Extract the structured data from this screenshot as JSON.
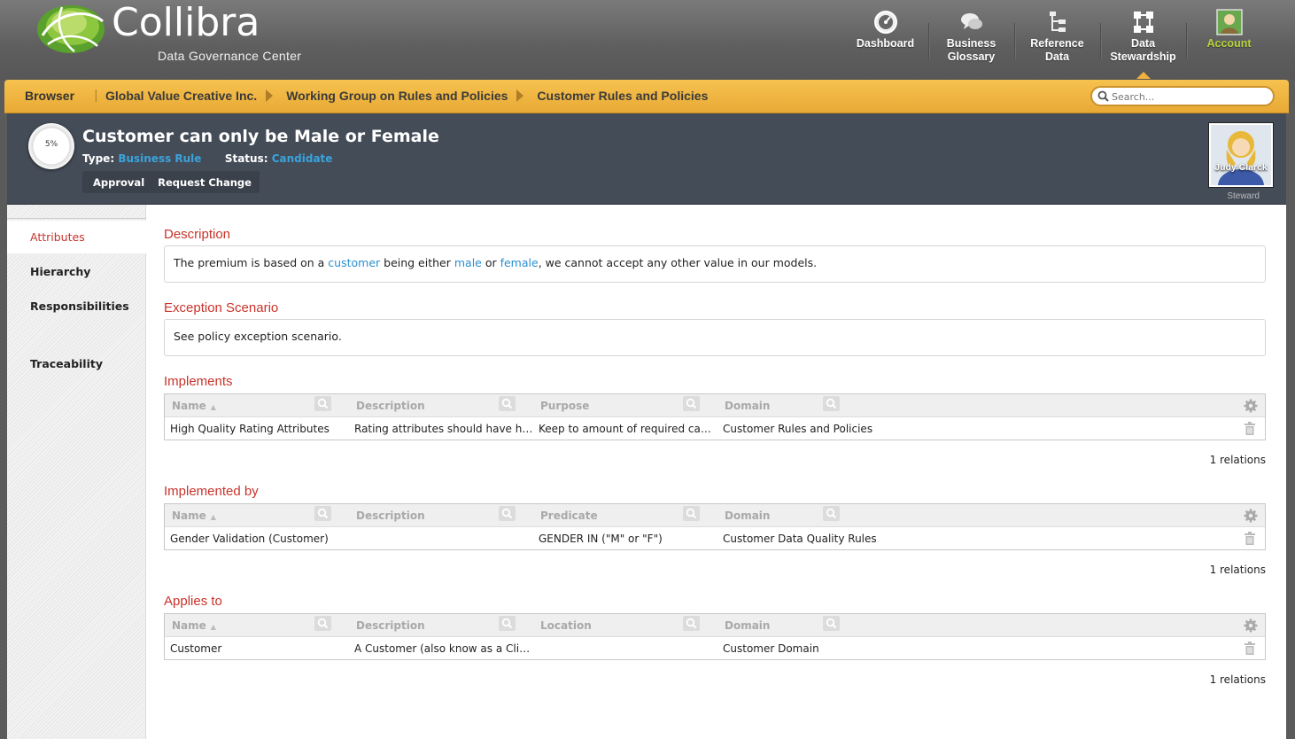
{
  "brand": {
    "name": "Collibra",
    "subtitle": "Data Governance Center",
    "logo_colors": [
      "#8dc63f",
      "#5aa02c",
      "#b9dc6a"
    ]
  },
  "nav": [
    {
      "label": "Dashboard",
      "icon": "dashboard-gauge-icon"
    },
    {
      "label": "Business\nGlossary",
      "icon": "speech-bubbles-icon"
    },
    {
      "label": "Reference\nData",
      "icon": "reference-tree-icon"
    },
    {
      "label": "Data\nStewardship",
      "icon": "stewardship-network-icon",
      "active": true
    },
    {
      "label": "Account",
      "icon": "user-avatar-icon"
    }
  ],
  "breadcrumb": {
    "root": "Browser",
    "separator": "|",
    "items": [
      "Global Value Creative Inc.",
      "Working Group on Rules and Policies",
      "Customer Rules and Policies"
    ]
  },
  "search": {
    "placeholder": "Search..."
  },
  "asset": {
    "progress": "5%",
    "title": "Customer can only be Male or Female",
    "type_label": "Type:",
    "type_value": "Business Rule",
    "status_label": "Status:",
    "status_value": "Candidate",
    "actions": [
      "Approval",
      "Request Change"
    ],
    "steward_name": "Judy Clarck",
    "steward_role": "Steward"
  },
  "sidebar": [
    "Attributes",
    "Hierarchy",
    "Responsibilities",
    "Traceability"
  ],
  "description": {
    "title": "Description",
    "parts": [
      "The premium is based on a ",
      "customer",
      " being either ",
      "male",
      " or ",
      "female",
      ", we cannot accept any other value in our models."
    ]
  },
  "exception": {
    "title": "Exception Scenario",
    "text": "See policy exception scenario."
  },
  "implements": {
    "title": "Implements",
    "columns": [
      "Name",
      "Description",
      "Purpose",
      "Domain"
    ],
    "row": [
      "High Quality Rating Attributes",
      "Rating attributes should have h…",
      "Keep to amount of required ca…",
      "Customer Rules and Policies"
    ],
    "relations": "1 relations"
  },
  "implemented_by": {
    "title": "Implemented by",
    "columns": [
      "Name",
      "Description",
      "Predicate",
      "Domain"
    ],
    "row": [
      "Gender Validation (Customer)",
      "",
      "GENDER IN (\"M\" or \"F\")",
      "Customer Data Quality Rules"
    ],
    "relations": "1 relations"
  },
  "applies_to": {
    "title": "Applies to",
    "columns": [
      "Name",
      "Description",
      "Location",
      "Domain"
    ],
    "row": [
      "Customer",
      "A Customer (also know as a Cli…",
      "",
      "Customer Domain"
    ],
    "relations": "1 relations"
  },
  "colors": {
    "accent_red": "#c9332a",
    "link_blue": "#2a8fcf",
    "breadcrumb_orange": "#f0b23c",
    "account_green": "#b6d33a"
  }
}
